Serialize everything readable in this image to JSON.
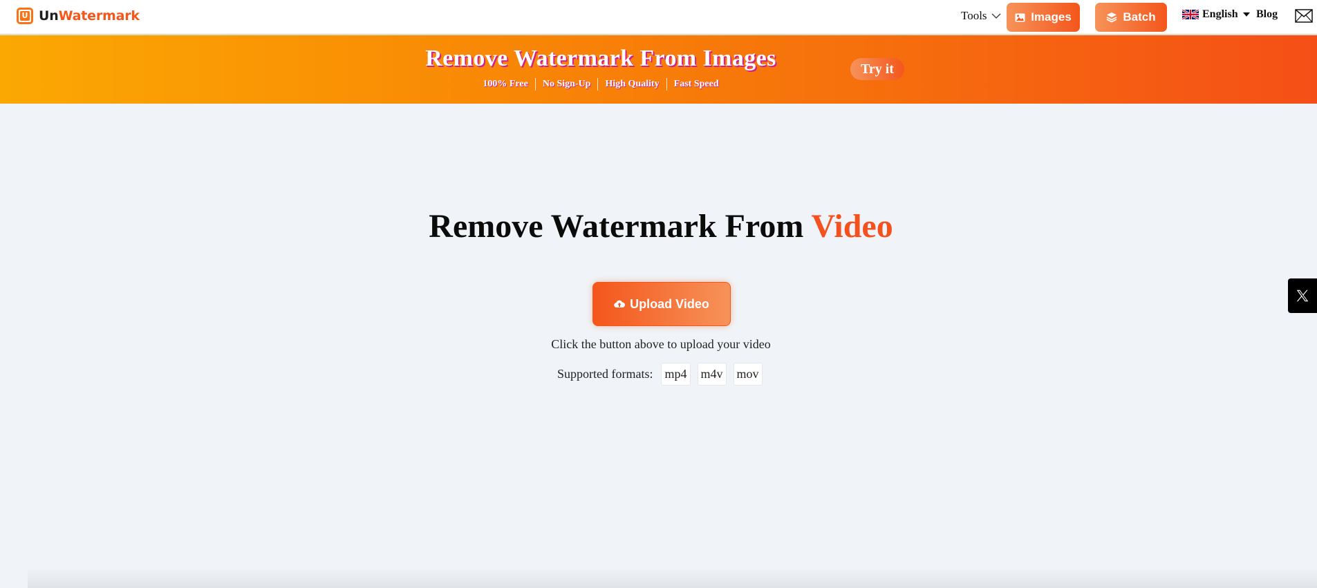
{
  "header": {
    "logo": {
      "prefix": "Un",
      "suffix": "Watermark",
      "mark_letter": "U"
    },
    "nav": {
      "tools_label": "Tools",
      "images_label": "Images",
      "batch_label": "Batch",
      "language_label": "English",
      "blog_label": "Blog"
    },
    "icons": {
      "tools": "chevron-down-icon",
      "images": "image-icon",
      "batch": "layers-icon",
      "language": "uk-flag-icon",
      "mail": "mail-icon"
    }
  },
  "banner": {
    "title": "Remove Watermark From Images",
    "features": [
      "100% Free",
      "No Sign-Up",
      "High Quality",
      "Fast Speed"
    ],
    "cta_label": "Try it"
  },
  "main": {
    "title_prefix": "Remove Watermark From ",
    "title_accent": "Video",
    "upload_label": "Upload Video",
    "upload_icon": "cloud-upload-icon",
    "hint": "Click the button above to upload your video",
    "formats_label": "Supported formats:",
    "formats": [
      "mp4",
      "m4v",
      "mov"
    ]
  },
  "social": {
    "x_icon": "x-logo-icon"
  },
  "colors": {
    "brand": "#f4561b",
    "brand_light": "#f6935a",
    "banner_start": "#fba803",
    "banner_end": "#f54f17",
    "title_shadow": "#d61d8c",
    "page_bg": "#f0f4f8"
  }
}
